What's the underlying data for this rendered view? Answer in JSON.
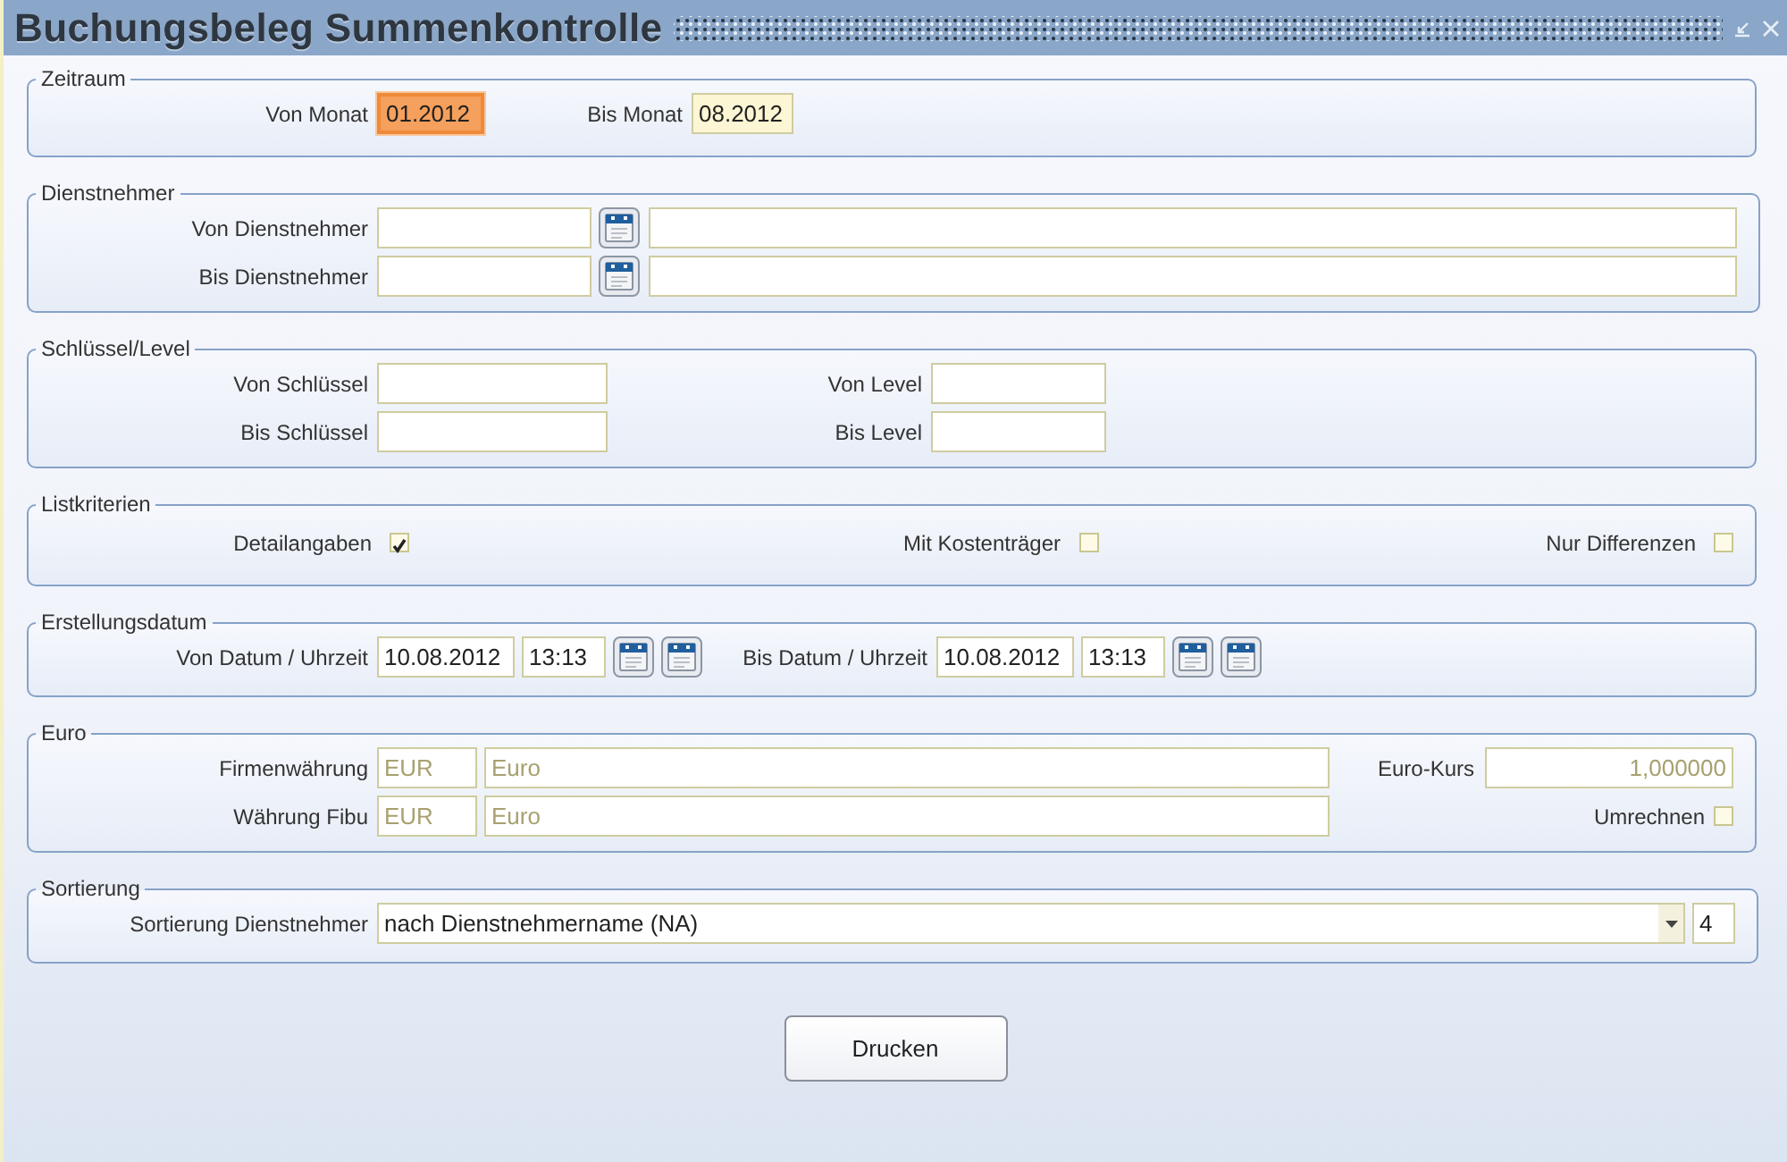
{
  "window": {
    "title": "Buchungsbeleg Summenkontrolle"
  },
  "zeitraum": {
    "legend": "Zeitraum",
    "fields": [
      {
        "label": "Von Monat",
        "value": "01.2012",
        "focused": true
      },
      {
        "label": "Bis Monat",
        "value": "08.2012",
        "focused": false
      }
    ]
  },
  "dienstnehmer": {
    "legend": "Dienstnehmer",
    "rows": [
      {
        "label": "Von Dienstnehmer"
      },
      {
        "label": "Bis Dienstnehmer"
      }
    ]
  },
  "schluessel_level": {
    "legend": "Schlüssel/Level",
    "rows": [
      {
        "left_label": "Von Schlüssel",
        "right_label": "Von Level"
      },
      {
        "left_label": "Bis Schlüssel",
        "right_label": "Bis Level"
      }
    ]
  },
  "listkriterien": {
    "legend": "Listkriterien",
    "checkboxes": [
      {
        "label": "Detailangaben",
        "checked": true
      },
      {
        "label": "Mit Kostenträger",
        "checked": false
      },
      {
        "label": "Nur Differenzen",
        "checked": false
      }
    ]
  },
  "erstellungsdatum": {
    "legend": "Erstellungsdatum",
    "ranges": [
      {
        "label": "Von Datum / Uhrzeit",
        "date": "10.08.2012",
        "time": "13:13"
      },
      {
        "label": "Bis Datum / Uhrzeit",
        "date": "10.08.2012",
        "time": "13:13"
      }
    ]
  },
  "euro": {
    "legend": "Euro",
    "rows": [
      {
        "label": "Firmenwährung",
        "code": "EUR",
        "name": "Euro",
        "disabled": true
      },
      {
        "label": "Währung Fibu",
        "code": "EUR",
        "name": "Euro",
        "disabled": true
      }
    ],
    "rate": {
      "label": "Euro-Kurs",
      "value": "1,000000",
      "disabled": true
    },
    "convert": {
      "label": "Umrechnen",
      "checked": false
    }
  },
  "sortierung": {
    "legend": "Sortierung",
    "label": "Sortierung Dienstnehmer",
    "value": "nach Dienstnehmername (NA)",
    "number": "4"
  },
  "buttons": [
    "Drucken"
  ]
}
